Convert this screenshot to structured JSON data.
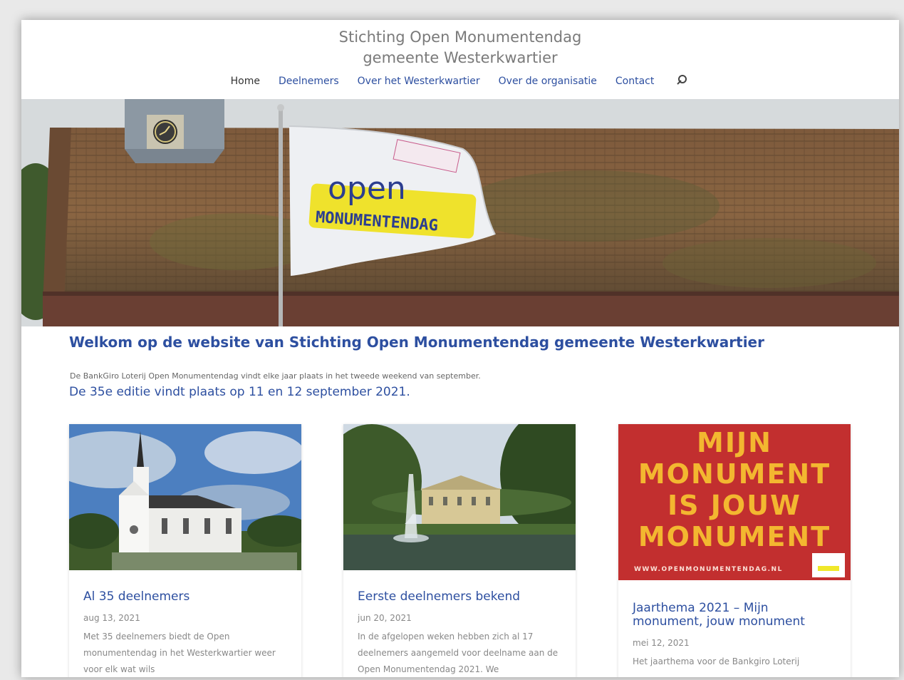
{
  "site": {
    "title_line1": "Stichting Open Monumentendag",
    "title_line2": "gemeente Westerkwartier"
  },
  "nav": {
    "items": [
      {
        "label": "Home"
      },
      {
        "label": "Deelnemers"
      },
      {
        "label": "Over het Westerkwartier"
      },
      {
        "label": "Over de organisatie"
      },
      {
        "label": "Contact"
      }
    ],
    "search_icon": "search-icon"
  },
  "hero": {
    "flag_text_top": "open",
    "flag_text_bottom": "MONUMENTENDAG"
  },
  "main": {
    "welcome": "Welkom op de website van Stichting Open Monumentendag gemeente Westerkwartier",
    "intro": "De BankGiro Loterij Open Monumentendag vindt elke jaar plaats in het tweede weekend van september.",
    "edition": "De 35e editie vindt plaats op 11 en 12 september 2021."
  },
  "posts": [
    {
      "title": "Al 35 deelnemers",
      "date": "aug 13, 2021",
      "excerpt": "Met 35 deelnemers biedt de Open monumentendag in het Westerkwartier weer voor elk wat wils"
    },
    {
      "title": "Eerste deelnemers bekend",
      "date": "jun 20, 2021",
      "excerpt": "In de afgelopen weken hebben zich al 17 deelnemers aangemeld voor deelname aan de Open Monumentendag 2021. We"
    },
    {
      "title": "Jaarthema 2021 – Mijn monument, jouw monument",
      "date": "mei 12, 2021",
      "excerpt": "Het jaarthema voor de Bankgiro Loterij"
    }
  ],
  "poster": {
    "line1": "MIJN",
    "line2": "MONUMENT",
    "line3": "IS JOUW",
    "line4": "MONUMENT",
    "url": "WWW.OPENMONUMENTENDAG.NL"
  },
  "colors": {
    "link": "#2d4fa0",
    "poster_red": "#c22f2f",
    "poster_yellow": "#f3b730"
  }
}
